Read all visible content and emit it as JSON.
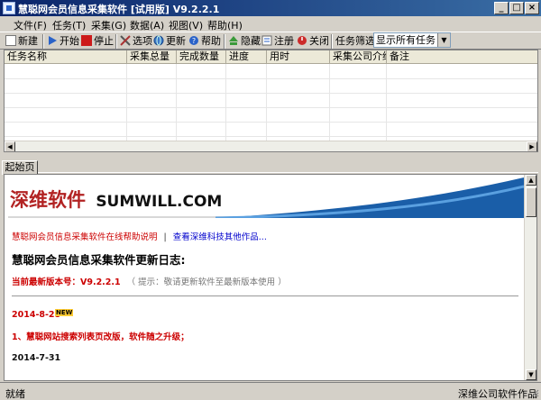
{
  "window": {
    "title": "慧聪网会员信息采集软件 [试用版] V9.2.2.1",
    "min_glyph": "_",
    "max_glyph": "□",
    "close_glyph": "×"
  },
  "menu": [
    "文件(F)",
    "任务(T)",
    "采集(G)",
    "数据(A)",
    "视图(V)",
    "帮助(H)"
  ],
  "toolbar": {
    "new": "新建",
    "start": "开始",
    "stop": "停止",
    "options": "选项",
    "update": "更新",
    "help": "帮助",
    "hide": "隐藏",
    "register": "注册",
    "close": "关闭",
    "filter_label": "任务筛选:",
    "filter_value": "显示所有任务"
  },
  "table": {
    "columns": [
      "任务名称",
      "采集总量",
      "完成数量",
      "进度",
      "用时",
      "采集公司介绍",
      "备注"
    ]
  },
  "tabs": [
    "起始页"
  ],
  "web": {
    "logo_cn": "深维软件",
    "logo_en": "SUMWILL.COM",
    "link_help": "慧聪网会员信息采集软件在线帮助说明",
    "link_sep": "|",
    "link_more": "查看深维科技其他作品...",
    "heading": "慧聪网会员信息采集软件更新日志:",
    "version_label": "当前最新版本号：V9.2.2.1",
    "version_hint": "（ 提示：敬请更新软件至最新版本使用 ）",
    "date1": "2014-8-28",
    "new_badge": "NEW",
    "note1": "1、慧聪网站搜索列表页改版，软件随之升级；",
    "date2": "2014-7-31"
  },
  "status": {
    "left": "就绪",
    "right": "深维公司软件作品"
  },
  "colors": {
    "title_bar": "#0a246a",
    "brand_red": "#b22222",
    "link_red": "#cc0000",
    "link_blue": "#0000cc",
    "banner_blue": "#1a5ea8"
  }
}
